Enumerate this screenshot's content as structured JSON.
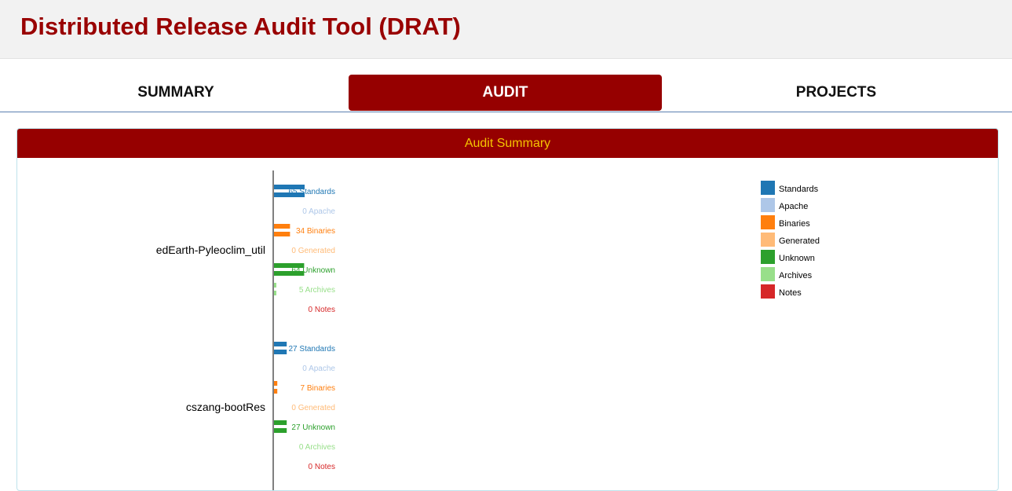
{
  "app": {
    "title": "Distributed Release Audit Tool (DRAT)"
  },
  "tabs": [
    {
      "label": "SUMMARY",
      "active": false
    },
    {
      "label": "AUDIT",
      "active": true
    },
    {
      "label": "PROJECTS",
      "active": false
    }
  ],
  "panel": {
    "title": "Audit Summary"
  },
  "chart_data": {
    "type": "bar",
    "orientation": "horizontal",
    "categories": [
      "edEarth-Pyleoclim_util",
      "cszang-bootRes"
    ],
    "series": [
      {
        "name": "Standards",
        "color": "#1f77b4",
        "values": [
          65,
          27
        ]
      },
      {
        "name": "Apache",
        "color": "#aec7e8",
        "values": [
          0,
          0
        ]
      },
      {
        "name": "Binaries",
        "color": "#ff7f0e",
        "values": [
          34,
          7
        ]
      },
      {
        "name": "Generated",
        "color": "#ffbb78",
        "values": [
          0,
          0
        ]
      },
      {
        "name": "Unknown",
        "color": "#2ca02c",
        "values": [
          64,
          27
        ]
      },
      {
        "name": "Archives",
        "color": "#98df8a",
        "values": [
          5,
          0
        ]
      },
      {
        "name": "Notes",
        "color": "#d62728",
        "values": [
          0,
          0
        ]
      }
    ],
    "legend": [
      "Standards",
      "Apache",
      "Binaries",
      "Generated",
      "Unknown",
      "Archives",
      "Notes"
    ],
    "legend_position": "top-right",
    "grid": false
  },
  "colors": {
    "brand": "#960000",
    "heading_text": "#f5c400"
  }
}
